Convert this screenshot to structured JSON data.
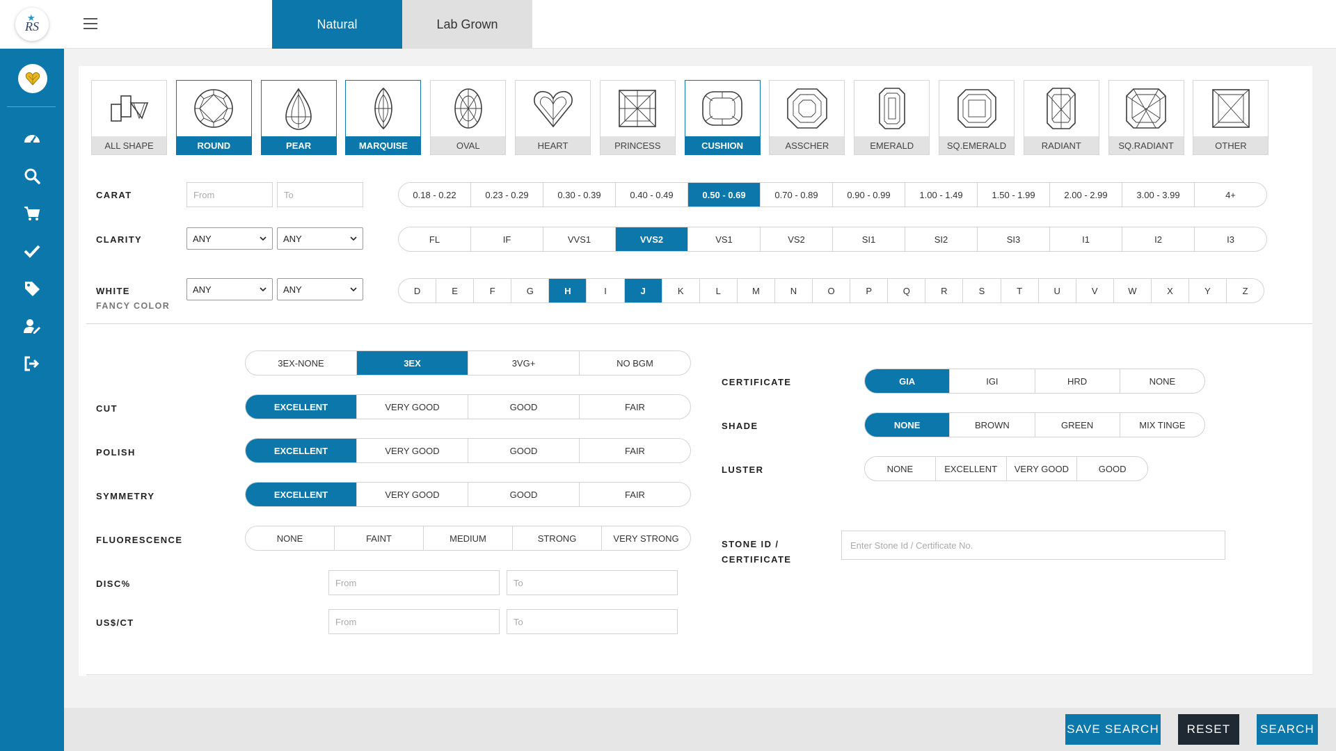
{
  "app": {
    "logo_text": "RS"
  },
  "tabs": {
    "natural": "Natural",
    "lab_grown": "Lab Grown"
  },
  "shapes": [
    {
      "label": "ALL SHAPE",
      "icon": "all-shape-icon",
      "selected": false
    },
    {
      "label": "ROUND",
      "icon": "round-diamond-icon",
      "selected": true
    },
    {
      "label": "PEAR",
      "icon": "pear-diamond-icon",
      "selected": true
    },
    {
      "label": "MARQUISE",
      "icon": "marquise-diamond-icon",
      "selected": true
    },
    {
      "label": "OVAL",
      "icon": "oval-diamond-icon",
      "selected": false
    },
    {
      "label": "HEART",
      "icon": "heart-diamond-icon",
      "selected": false
    },
    {
      "label": "PRINCESS",
      "icon": "princess-diamond-icon",
      "selected": false
    },
    {
      "label": "CUSHION",
      "icon": "cushion-diamond-icon",
      "selected": true
    },
    {
      "label": "ASSCHER",
      "icon": "asscher-diamond-icon",
      "selected": false
    },
    {
      "label": "EMERALD",
      "icon": "emerald-diamond-icon",
      "selected": false
    },
    {
      "label": "SQ.EMERALD",
      "icon": "sq-emerald-diamond-icon",
      "selected": false
    },
    {
      "label": "RADIANT",
      "icon": "radiant-diamond-icon",
      "selected": false
    },
    {
      "label": "SQ.RADIANT",
      "icon": "sq-radiant-diamond-icon",
      "selected": false
    },
    {
      "label": "OTHER",
      "icon": "other-diamond-icon",
      "selected": false
    }
  ],
  "carat": {
    "label": "CARAT",
    "from_placeholder": "From",
    "to_placeholder": "To",
    "ranges": [
      "0.18 - 0.22",
      "0.23 - 0.29",
      "0.30 - 0.39",
      "0.40 - 0.49",
      "0.50 - 0.69",
      "0.70 - 0.89",
      "0.90 - 0.99",
      "1.00 - 1.49",
      "1.50 - 1.99",
      "2.00 - 2.99",
      "3.00 - 3.99",
      "4+"
    ],
    "selected": [
      "0.50 - 0.69"
    ]
  },
  "clarity": {
    "label": "CLARITY",
    "from_value": "ANY",
    "to_value": "ANY",
    "options": [
      "FL",
      "IF",
      "VVS1",
      "VVS2",
      "VS1",
      "VS2",
      "SI1",
      "SI2",
      "SI3",
      "I1",
      "I2",
      "I3"
    ],
    "selected": [
      "VVS2"
    ]
  },
  "color": {
    "label": "WHITE",
    "sub_label": "FANCY COLOR",
    "from_value": "ANY",
    "to_value": "ANY",
    "options": [
      "D",
      "E",
      "F",
      "G",
      "H",
      "I",
      "J",
      "K",
      "L",
      "M",
      "N",
      "O",
      "P",
      "Q",
      "R",
      "S",
      "T",
      "U",
      "V",
      "W",
      "X",
      "Y",
      "Z"
    ],
    "selected": [
      "H",
      "J"
    ]
  },
  "cut_presets": {
    "options": [
      "3EX-NONE",
      "3EX",
      "3VG+",
      "NO BGM"
    ],
    "selected": [
      "3EX"
    ]
  },
  "cut": {
    "label": "CUT",
    "options": [
      "EXCELLENT",
      "VERY GOOD",
      "GOOD",
      "FAIR"
    ],
    "selected": [
      "EXCELLENT"
    ]
  },
  "polish": {
    "label": "POLISH",
    "options": [
      "EXCELLENT",
      "VERY GOOD",
      "GOOD",
      "FAIR"
    ],
    "selected": [
      "EXCELLENT"
    ]
  },
  "symmetry": {
    "label": "SYMMETRY",
    "options": [
      "EXCELLENT",
      "VERY GOOD",
      "GOOD",
      "FAIR"
    ],
    "selected": [
      "EXCELLENT"
    ]
  },
  "fluorescence": {
    "label": "FLUORESCENCE",
    "options": [
      "NONE",
      "FAINT",
      "MEDIUM",
      "STRONG",
      "VERY STRONG"
    ],
    "selected": []
  },
  "disc": {
    "label": "DISC%",
    "from_placeholder": "From",
    "to_placeholder": "To"
  },
  "usct": {
    "label": "US$/CT",
    "from_placeholder": "From",
    "to_placeholder": "To"
  },
  "certificate": {
    "label": "CERTIFICATE",
    "options": [
      "GIA",
      "IGI",
      "HRD",
      "NONE"
    ],
    "selected": [
      "GIA"
    ]
  },
  "shade": {
    "label": "SHADE",
    "options": [
      "NONE",
      "BROWN",
      "GREEN",
      "MIX TINGE"
    ],
    "selected": [
      "NONE"
    ]
  },
  "luster": {
    "label": "LUSTER",
    "options": [
      "NONE",
      "EXCELLENT",
      "VERY GOOD",
      "GOOD"
    ],
    "selected": []
  },
  "stone_id": {
    "label_1": "STONE ID /",
    "label_2": "CERTIFICATE",
    "placeholder": "Enter Stone Id / Certificate No."
  },
  "footer": {
    "save_search": "SAVE SEARCH",
    "reset": "RESET",
    "search": "SEARCH"
  },
  "colors": {
    "primary": "#0b77ab",
    "dark": "#1f2933",
    "tab_inactive": "#e0e0e0"
  },
  "sidebar_icons": [
    "dashboard-icon",
    "search-icon",
    "cart-icon",
    "check-icon",
    "tag-icon",
    "user-edit-icon",
    "logout-icon"
  ]
}
